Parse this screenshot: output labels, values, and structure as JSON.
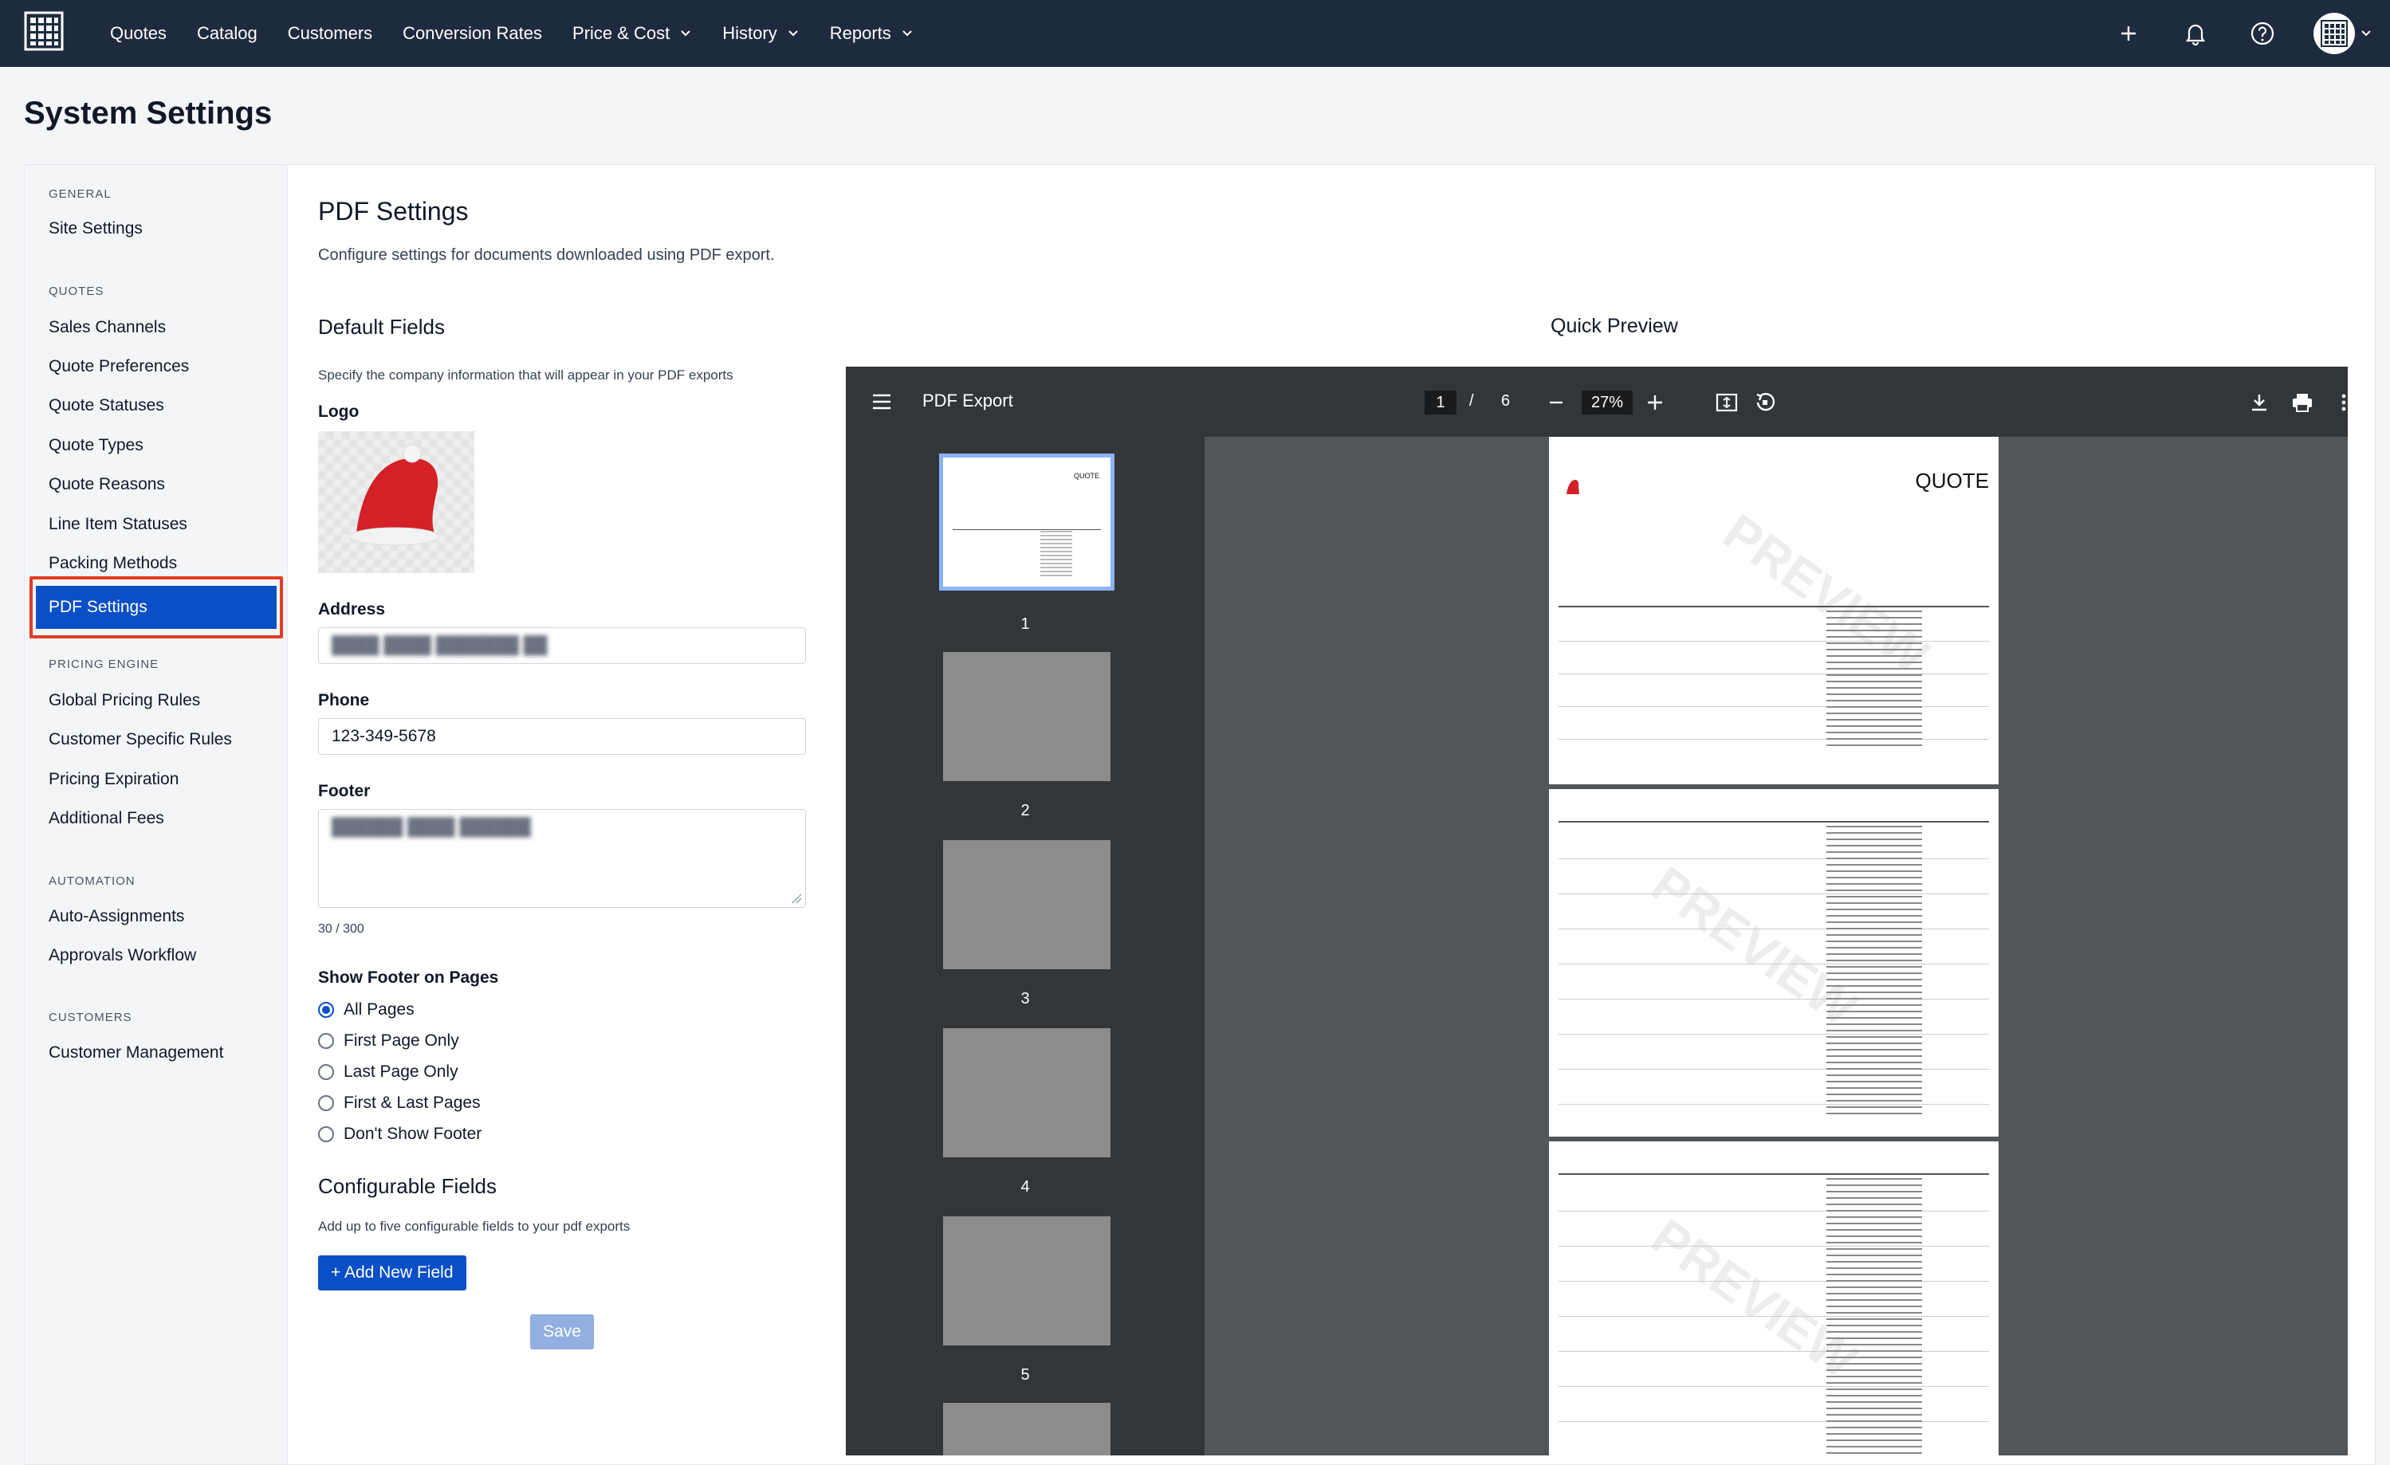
{
  "nav": {
    "items": [
      {
        "label": "Quotes",
        "dropdown": false
      },
      {
        "label": "Catalog",
        "dropdown": false
      },
      {
        "label": "Customers",
        "dropdown": false
      },
      {
        "label": "Conversion Rates",
        "dropdown": false
      },
      {
        "label": "Price & Cost",
        "dropdown": true
      },
      {
        "label": "History",
        "dropdown": true
      },
      {
        "label": "Reports",
        "dropdown": true
      }
    ]
  },
  "page_title": "System Settings",
  "sidebar": {
    "sections": [
      {
        "title": "GENERAL",
        "items": [
          "Site Settings"
        ]
      },
      {
        "title": "QUOTES",
        "items": [
          "Sales Channels",
          "Quote Preferences",
          "Quote Statuses",
          "Quote Types",
          "Quote Reasons",
          "Line Item Statuses",
          "Packing Methods",
          "PDF Settings"
        ]
      },
      {
        "title": "PRICING ENGINE",
        "items": [
          "Global Pricing Rules",
          "Customer Specific Rules",
          "Pricing Expiration",
          "Additional Fees"
        ]
      },
      {
        "title": "AUTOMATION",
        "items": [
          "Auto-Assignments",
          "Approvals Workflow"
        ]
      },
      {
        "title": "CUSTOMERS",
        "items": [
          "Customer Management"
        ]
      }
    ],
    "active": "PDF Settings"
  },
  "pdf_settings": {
    "title": "PDF Settings",
    "description": "Configure settings for documents downloaded using PDF export.",
    "default_fields_title": "Default Fields",
    "default_fields_desc": "Specify the company information that will appear in your PDF exports",
    "logo_label": "Logo",
    "address_label": "Address",
    "address_value": "████ ████ ███████ ██",
    "phone_label": "Phone",
    "phone_value": "123-349-5678",
    "footer_label": "Footer",
    "footer_value": "██████ ████ ██████",
    "footer_count": "30 / 300",
    "show_footer_label": "Show Footer on Pages",
    "footer_options": [
      "All Pages",
      "First Page Only",
      "Last Page Only",
      "First & Last Pages",
      "Don't Show Footer"
    ],
    "footer_selected": "All Pages",
    "configurable_title": "Configurable Fields",
    "configurable_desc": "Add up to five configurable fields to your pdf exports",
    "add_field_button": "+ Add New Field",
    "save_button": "Save"
  },
  "preview": {
    "title": "Quick Preview",
    "viewer_title": "PDF Export",
    "current_page": "1",
    "page_separator": "/",
    "total_pages": "6",
    "zoom": "27%",
    "thumbnails": [
      "1",
      "2",
      "3",
      "4",
      "5"
    ],
    "page_heading": "QUOTE",
    "watermark": "PREVIEW"
  },
  "colors": {
    "nav_bg": "#1e2b3f",
    "accent": "#0b4fc6",
    "highlight": "#e23b26",
    "viewer_bg": "#525659",
    "viewer_toolbar": "#323639"
  }
}
